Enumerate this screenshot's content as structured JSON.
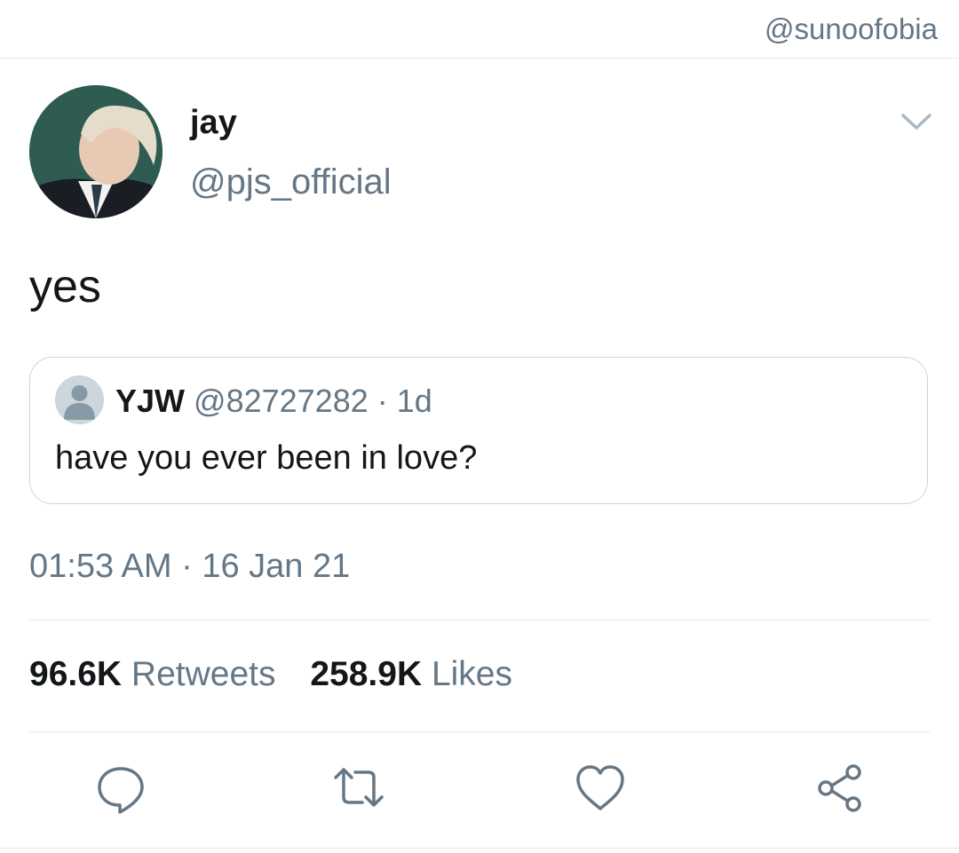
{
  "watermark": "@sunoofobia",
  "author": {
    "name": "jay",
    "handle": "@pjs_official"
  },
  "tweet": {
    "text": "yes",
    "timestamp": "01:53 AM · 16 Jan 21"
  },
  "quoted": {
    "name": "YJW",
    "meta": "@82727282 · 1d",
    "text": "have you ever been in love?"
  },
  "stats": {
    "retweets_count": "96.6K",
    "retweets_label": "Retweets",
    "likes_count": "258.9K",
    "likes_label": "Likes"
  },
  "icons": {
    "chevron": "chevron-down-icon",
    "reply": "reply-icon",
    "retweet": "retweet-icon",
    "like": "heart-icon",
    "share": "share-icon"
  },
  "colors": {
    "text": "#14171a",
    "secondary": "#657786",
    "border": "#ccd6dd",
    "divider": "#e1e8ed"
  }
}
